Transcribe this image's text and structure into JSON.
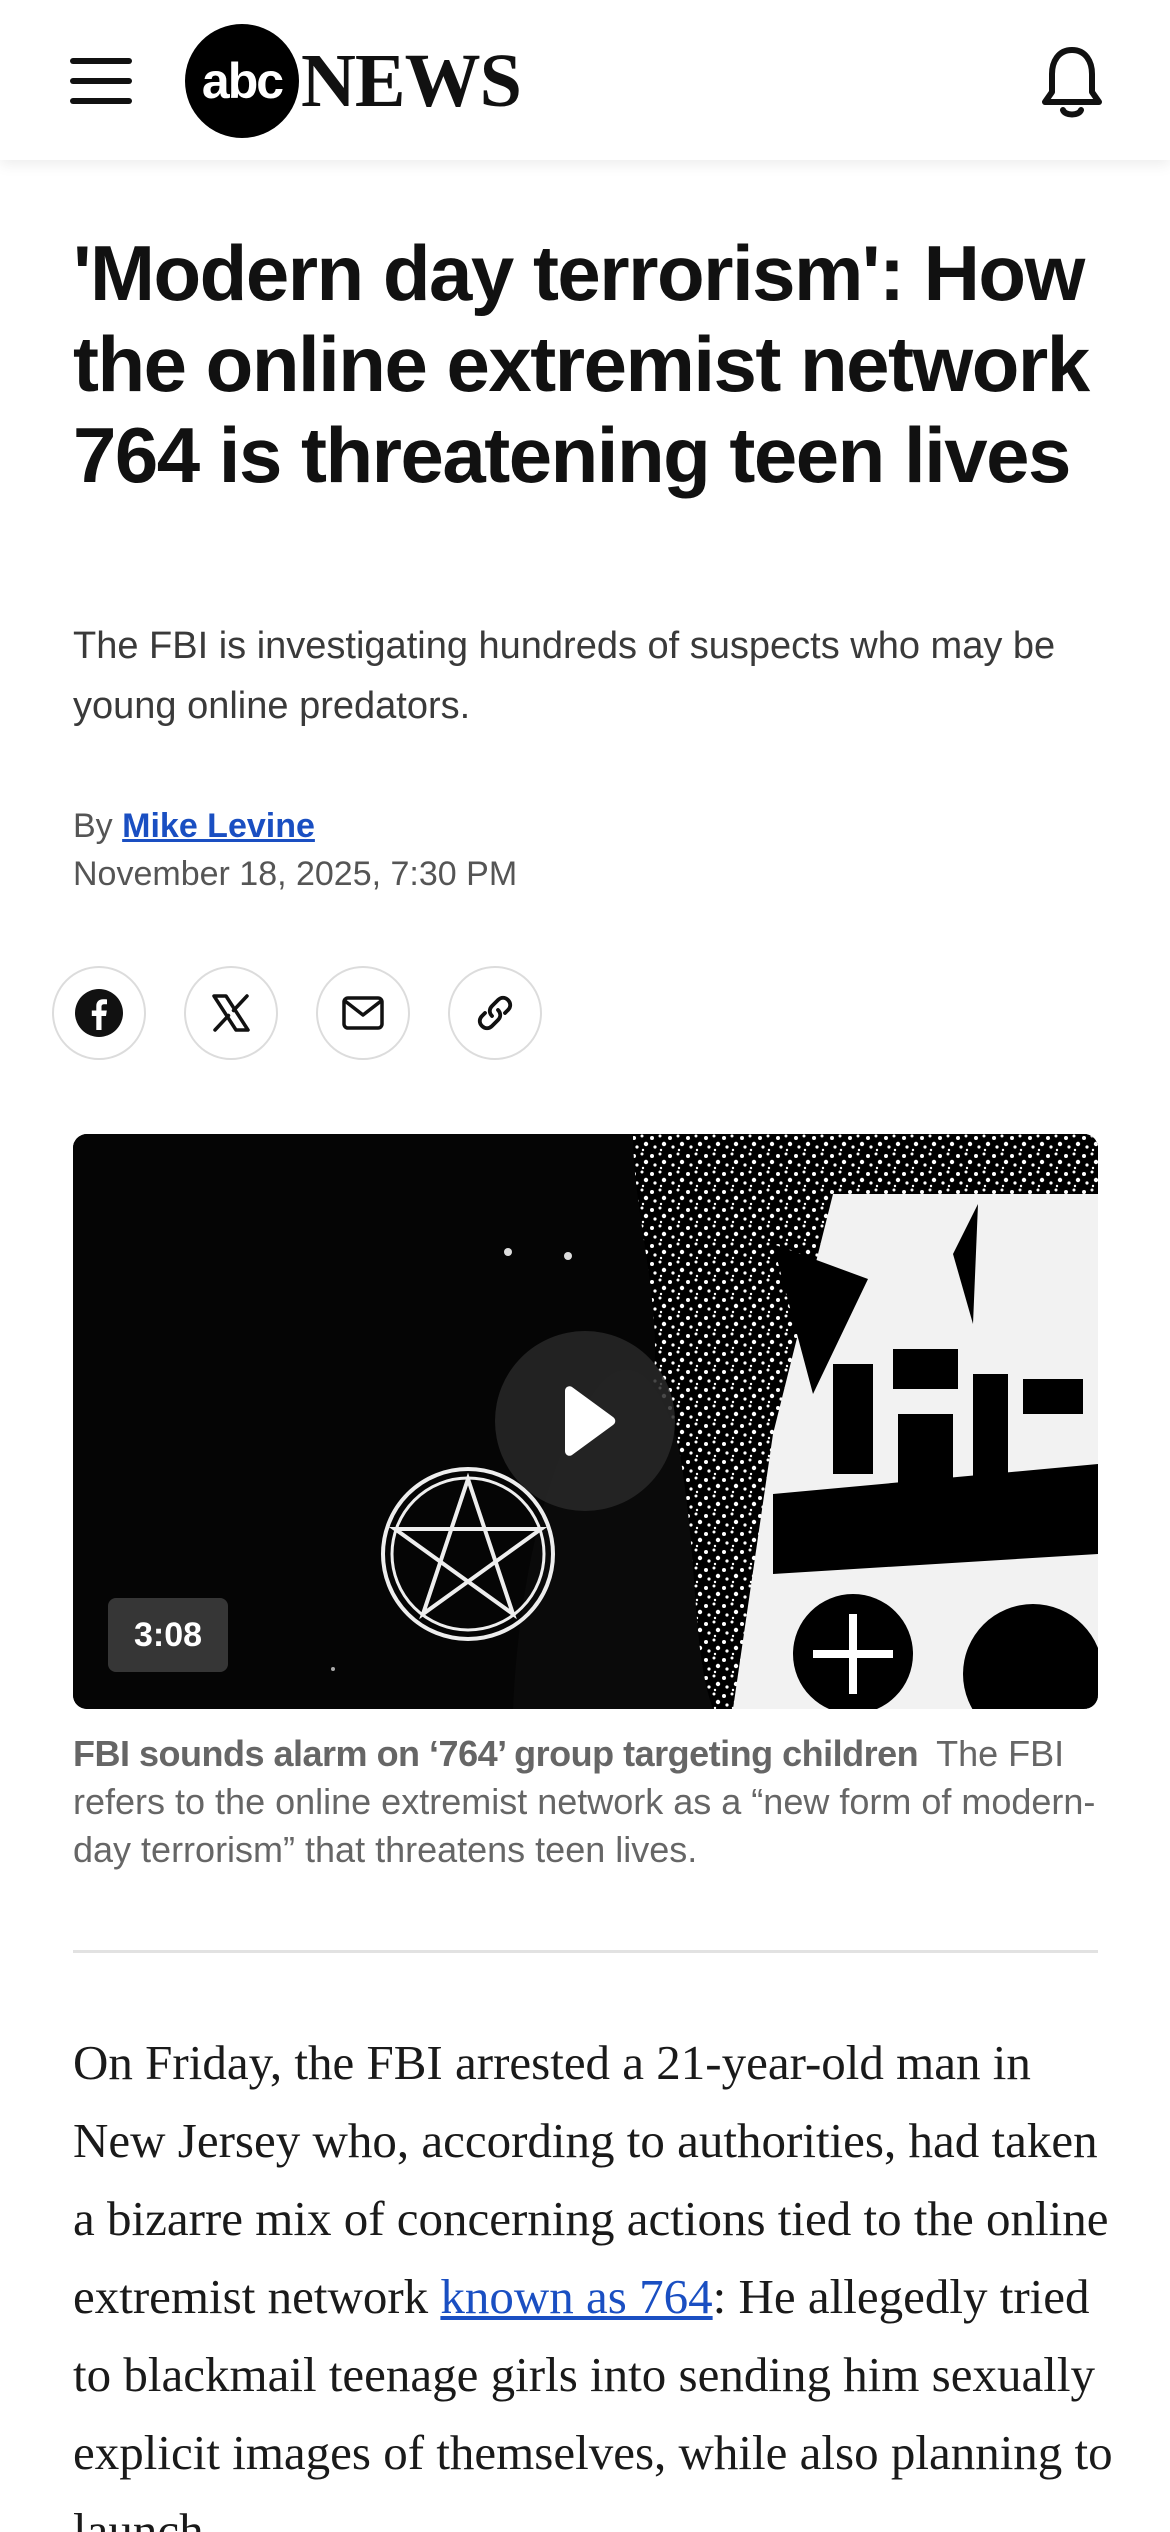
{
  "header": {
    "logo_abc": "abc",
    "logo_news": "NEWS",
    "menu_icon": "hamburger-icon",
    "bell_icon": "bell-icon"
  },
  "article": {
    "headline": "'Modern day terrorism': How the online extremist network 764 is threatening teen lives",
    "subhead": "The FBI is investigating hundreds of suspects who may be young online predators.",
    "byline_prefix": "By",
    "author": "Mike Levine",
    "date": "November 18, 2025, 7:30 PM"
  },
  "share": [
    {
      "icon": "facebook-icon"
    },
    {
      "icon": "x-icon"
    },
    {
      "icon": "mail-icon"
    },
    {
      "icon": "link-icon"
    }
  ],
  "video": {
    "duration": "3:08",
    "caption_title": "FBI sounds alarm on ‘764’ group targeting children",
    "caption_text": "The FBI refers to the online extremist network as a “new form of modern-day terrorism” that threatens teen lives."
  },
  "body": {
    "para1_before": "On Friday, the FBI arrested a 21-year-old man in New Jersey who, according to authorities, had taken a bizarre mix of concerning actions tied to the online extremist network ",
    "para1_link": "known as 764",
    "para1_after": ": He allegedly tried to blackmail teenage girls into sending him sexually explicit images of themselves, while also planning to launch"
  },
  "colors": {
    "link": "#1a4fc2",
    "text": "#111111",
    "muted": "#666666"
  }
}
